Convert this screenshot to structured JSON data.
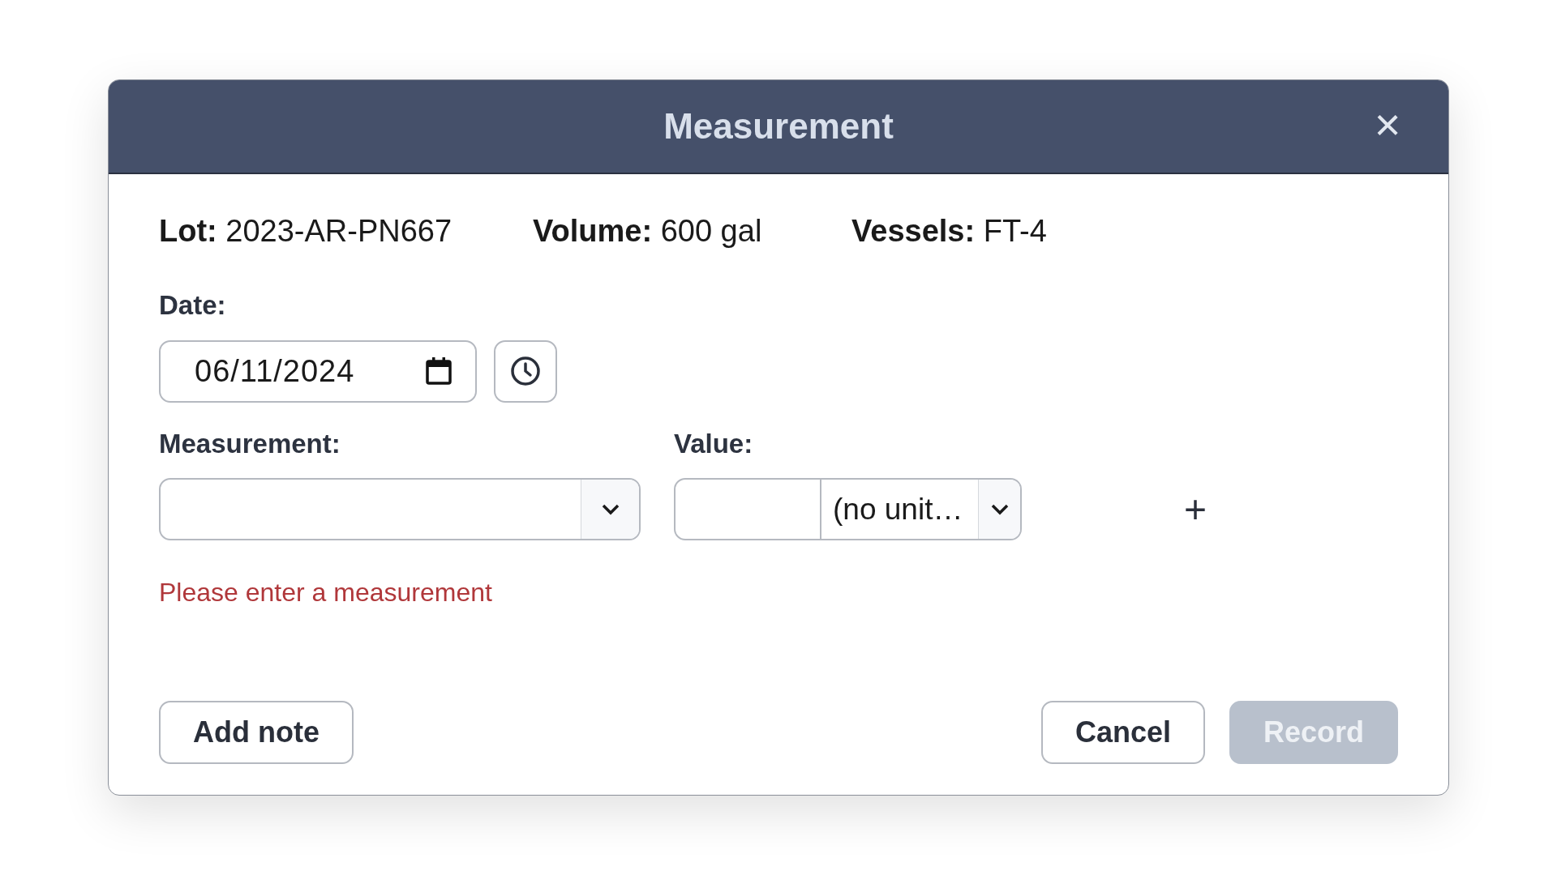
{
  "dialog": {
    "title": "Measurement",
    "close": "×"
  },
  "info": [
    {
      "label": "Lot:",
      "value": "2023-AR-PN667"
    },
    {
      "label": "Volume:",
      "value": "600 gal"
    },
    {
      "label": "Vessels:",
      "value": "FT-4"
    }
  ],
  "date": {
    "label": "Date:",
    "value": "06/11/2024"
  },
  "measurement": {
    "label": "Measurement:"
  },
  "value": {
    "label": "Value:",
    "unit": "(no unit…",
    "add": "+"
  },
  "error": "Please enter a measurement",
  "buttons": [
    {
      "label": "Add note",
      "kind": "secondary",
      "disabled": false
    },
    {
      "label": "Cancel",
      "kind": "secondary",
      "disabled": false
    },
    {
      "label": "Record",
      "kind": "primary",
      "disabled": true
    }
  ]
}
